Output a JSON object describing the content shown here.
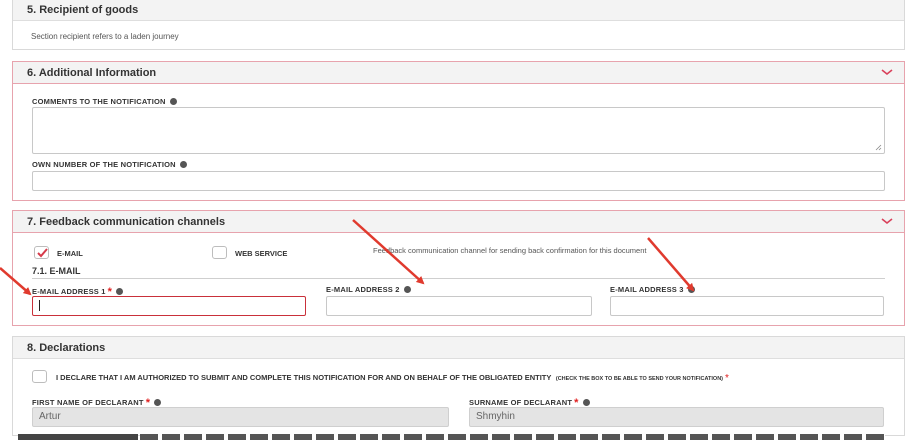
{
  "section5": {
    "title": "5. Recipient of goods",
    "note": "Section recipient refers to a laden journey"
  },
  "section6": {
    "title": "6. Additional Information",
    "comments_label": "COMMENTS TO THE NOTIFICATION",
    "own_number_label": "OWN NUMBER OF THE NOTIFICATION"
  },
  "section7": {
    "title": "7. Feedback communication channels",
    "email_option": "E-MAIL",
    "web_service_option": "WEB SERVICE",
    "channel_note": "Feedback communication channel for sending back confirmation for this document",
    "subsection_title": "7.1. E-MAIL",
    "email1_label": "E-MAIL ADDRESS 1",
    "email2_label": "E-MAIL ADDRESS 2",
    "email3_label": "E-MAIL ADDRESS 3"
  },
  "section8": {
    "title": "8. Declarations",
    "declare_text": "I DECLARE THAT I AM AUTHORIZED TO SUBMIT AND COMPLETE THIS NOTIFICATION FOR AND ON BEHALF OF THE OBLIGATED ENTITY",
    "declare_hint": "(CHECK THE BOX TO BE ABLE TO SEND YOUR NOTIFICATION)",
    "first_name_label": "FIRST NAME OF DECLARANT",
    "first_name_value": "Artur",
    "surname_label": "SURNAME OF DECLARANT",
    "surname_value": "Shmyhin"
  },
  "colors": {
    "accent_border": "#e7a3ad",
    "required_star": "#e02020",
    "arrow": "#e03a2e",
    "error_border": "#c9303a"
  }
}
